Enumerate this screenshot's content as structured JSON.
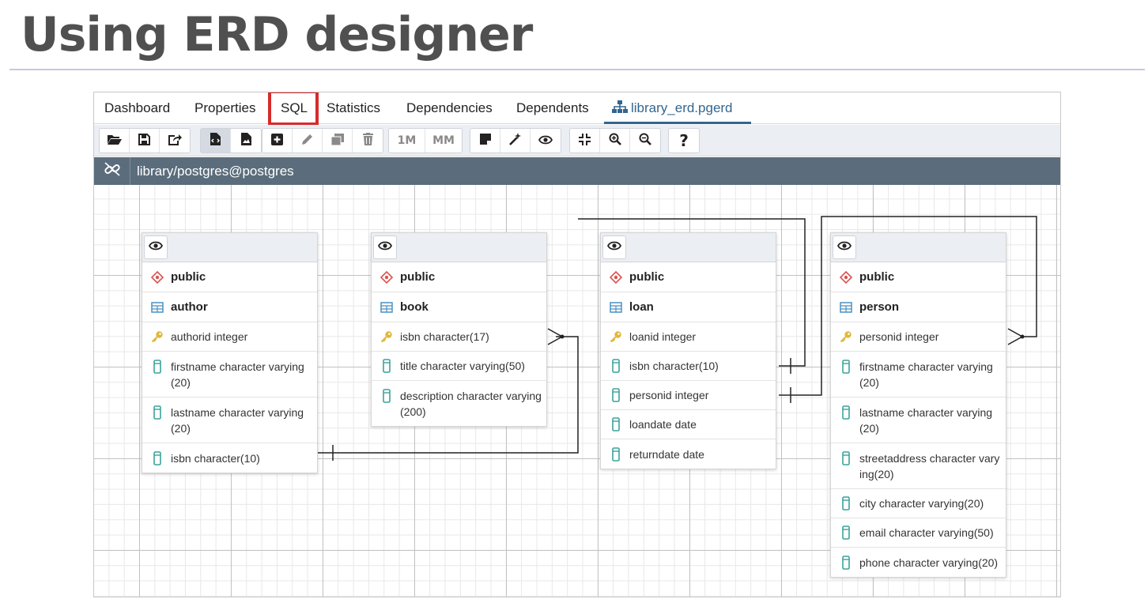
{
  "slide": {
    "title": "Using ERD designer"
  },
  "tabs": [
    {
      "label": "Dashboard"
    },
    {
      "label": "Properties"
    },
    {
      "label": "SQL"
    },
    {
      "label": "Statistics"
    },
    {
      "label": "Dependencies"
    },
    {
      "label": "Dependents"
    },
    {
      "label": "library_erd.pgerd"
    }
  ],
  "toolbar": {
    "one_to_many_label": "1M",
    "many_to_many_label": "MM",
    "help_label": "?"
  },
  "connection": {
    "label": "library/postgres@postgres"
  },
  "tables": [
    {
      "schema": "public",
      "name": "author",
      "columns": [
        {
          "text": "authorid integer",
          "pk": true
        },
        {
          "text": "firstname character varying (20)",
          "pk": false
        },
        {
          "text": "lastname character varying (20)",
          "pk": false
        },
        {
          "text": "isbn character(10)",
          "pk": false
        }
      ]
    },
    {
      "schema": "public",
      "name": "book",
      "columns": [
        {
          "text": "isbn character(17)",
          "pk": true
        },
        {
          "text": "title character varying(50)",
          "pk": false
        },
        {
          "text": "description character varying(200)",
          "pk": false
        }
      ]
    },
    {
      "schema": "public",
      "name": "loan",
      "columns": [
        {
          "text": "loanid integer",
          "pk": true
        },
        {
          "text": "isbn character(10)",
          "pk": false
        },
        {
          "text": "personid integer",
          "pk": false
        },
        {
          "text": "loandate date",
          "pk": false
        },
        {
          "text": "returndate date",
          "pk": false
        }
      ]
    },
    {
      "schema": "public",
      "name": "person",
      "columns": [
        {
          "text": "personid integer",
          "pk": true
        },
        {
          "text": "firstname character varying (20)",
          "pk": false
        },
        {
          "text": "lastname character varying (20)",
          "pk": false
        },
        {
          "text": "streetaddress character varying(20)",
          "pk": false
        },
        {
          "text": "city character varying(20)",
          "pk": false
        },
        {
          "text": "email character varying(50)",
          "pk": false
        },
        {
          "text": "phone character varying(20)",
          "pk": false
        }
      ]
    }
  ],
  "colors": {
    "accent": "#326690",
    "highlight": "#d62b2b",
    "connection_bar": "#5b6d7c",
    "schema_icon": "#d9534f",
    "table_icon": "#4a90c2",
    "key_icon": "#e0b83a",
    "column_icon": "#3aa39a"
  }
}
